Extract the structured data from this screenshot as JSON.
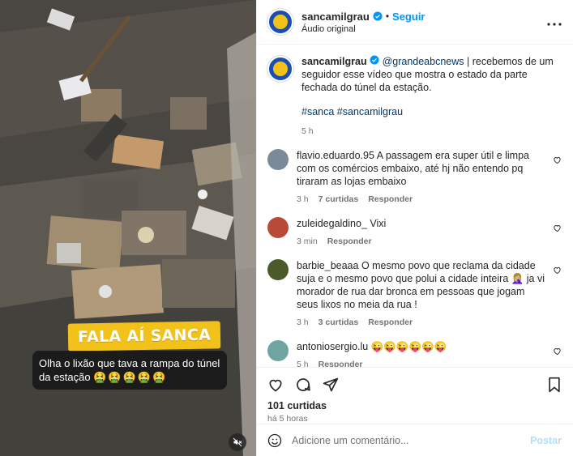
{
  "post": {
    "author": "sancamilgrau",
    "follow_label": "Seguir",
    "dot": "•",
    "audio": "Áudio original",
    "more_icon": "more-options-icon"
  },
  "video": {
    "tag": "FALA AÍ SANCA",
    "caption_text": "Olha o lixão que tava a rampa do túnel da estação",
    "caption_emoji": "🤮🤮🤮🤮🤮"
  },
  "caption": {
    "author": "sancamilgrau",
    "mention": "@grandeabcnews",
    "text": " | recebemos de um seguidor esse vídeo que mostra o estado da parte fechada do túnel da estação.",
    "hashtags": "#sanca #sancamilgrau",
    "time": "5 h"
  },
  "comments": [
    {
      "user": "flavio.eduardo.95",
      "text": "A passagem era super útil e limpa com os comércios embaixo, até hj não entendo pq tiraram as lojas embaixo",
      "time": "3 h",
      "likes": "7 curtidas",
      "reply": "Responder",
      "avatar_color": "#7a8a99"
    },
    {
      "user": "zuleidegaldino_",
      "text": "Vixi",
      "time": "3 min",
      "likes": "",
      "reply": "Responder",
      "avatar_color": "#b84a3a"
    },
    {
      "user": "barbie_beaaa",
      "text": "O mesmo povo que reclama da cidade suja e o mesmo povo que polui a cidade inteira 🤦🏼‍♀️ ja vi morador de rua dar bronca em pessoas que jogam seus lixos no meia da rua !",
      "time": "3 h",
      "likes": "3 curtidas",
      "reply": "Responder",
      "avatar_color": "#4a5a2a"
    },
    {
      "user": "antoniosergio.lu",
      "text": "😜😜😜😜😜😜",
      "time": "5 h",
      "likes": "",
      "reply": "Responder",
      "avatar_color": "#6fa5a0"
    }
  ],
  "footer": {
    "likes": "101 curtidas",
    "ago": "há 5 horas",
    "add_comment_placeholder": "Adicione um comentário...",
    "post_label": "Postar"
  },
  "colors": {
    "accent": "#0095f6",
    "mention": "#00376b",
    "tag_yellow": "#f3c21a"
  }
}
